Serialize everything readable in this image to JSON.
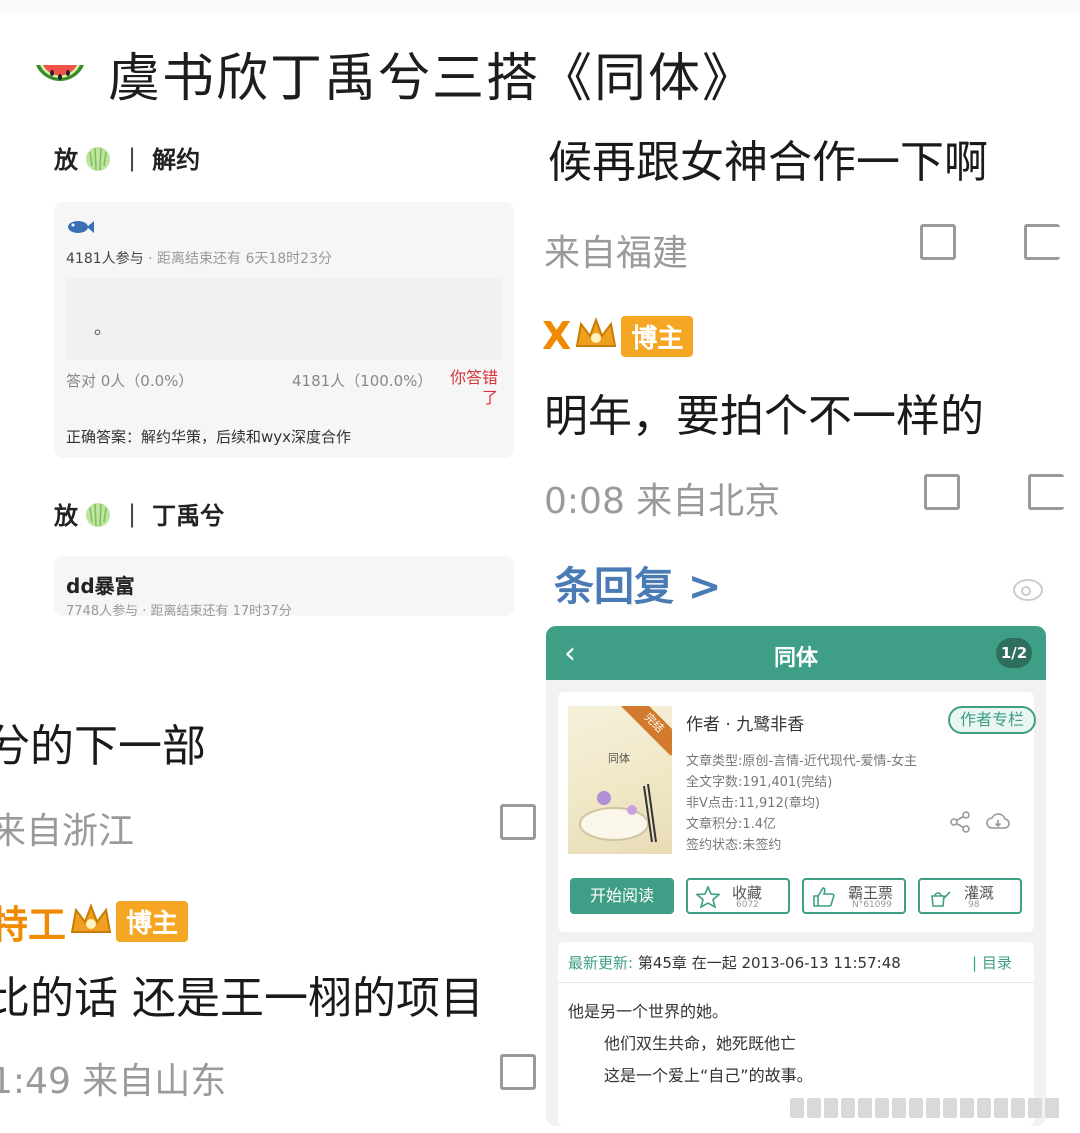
{
  "headline": {
    "text": "虞书欣丁禹兮三搭《同体》"
  },
  "quiz1": {
    "title_prefix": "放",
    "title_sep": "|",
    "title_topic": "解约",
    "participants": "4181人参与",
    "countdown": "· 距离结束还有 6天18时23分",
    "question_text": "。",
    "correct_stat": "答对  0人（0.0%）",
    "wrong_stat": "4181人（100.0%）",
    "wrong_badge": "你答错了",
    "answer": "正确答案：解约华策，后续和wyx深度合作"
  },
  "quiz2": {
    "title_prefix": "放",
    "title_sep": "|",
    "title_topic": "丁禹兮",
    "card_title": "dd暴富",
    "card_meta": "7748人参与 · 距离结束还有 17时37分"
  },
  "left_comments": {
    "line1": "兮的下一部",
    "loc1": "来自浙江",
    "user2": "特工",
    "badge_label": "博主",
    "line2": "比的话 还是王一栩的项目",
    "loc2": "1:49  来自山东"
  },
  "right_comments": {
    "line1": "候再跟女神合作一下啊",
    "loc1": "来自福建",
    "user2": "X",
    "badge_label": "博主",
    "line2": "明年，要拍个不一样的",
    "loc2": "0:08  来自北京",
    "reply": "条回复 >"
  },
  "book": {
    "header_title": "同体",
    "page": "1/2",
    "cover_tag": "完结",
    "cover_title": "同体",
    "author": "作者 · 九鹭非香",
    "author_btn": "作者专栏",
    "type": "文章类型:原创-言情-近代现代-爱情-女主",
    "words": "全文字数:191,401(完结)",
    "clicks": "非V点击:11,912(章均)",
    "score": "文章积分:1.4亿",
    "sign": "签约状态:未签约",
    "read_btn": "开始阅读",
    "fav_label": "收藏",
    "fav_num": "6072",
    "bawang_label": "霸王票",
    "bawang_num": "N°61099",
    "water_label": "灌溉",
    "water_num": "98",
    "latest_label": "最新更新:",
    "latest_text": "第45章 在一起 2013-06-13 11:57:48",
    "toc": "| 目录",
    "syn1": "他是另一个世界的她。",
    "syn2": "他们双生共命，她死既他亡",
    "syn3": "这是一个爱上“自己”的故事。"
  },
  "colors": {
    "accent": "#3f9e86",
    "badge": "#f5a623",
    "link": "#4a7bb5",
    "wrong": "#d9323a"
  }
}
